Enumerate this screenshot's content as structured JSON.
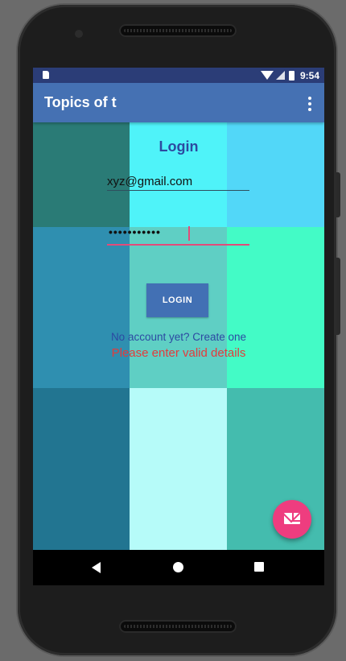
{
  "status_bar": {
    "time": "9:54"
  },
  "app_bar": {
    "title": "Topics of t"
  },
  "login": {
    "title": "Login",
    "email_value": "xyz@gmail.com",
    "password_mask": "•••••••••••",
    "button_label": "LOGIN",
    "create_account_text": "No account yet? Create one",
    "error_text": "Please enter valid details"
  },
  "colors": {
    "status_bar": "#2b3d77",
    "app_bar": "#4571b3",
    "login_title": "#2d4aa0",
    "error": "#e33b3b",
    "fab": "#ee3d7f",
    "grid": [
      "#2a7b76",
      "#4ff3f9",
      "#52d7f8",
      "#2f8fb0",
      "#5fcfc4",
      "#43fbc6",
      "#227591",
      "#b6fbf9",
      "#44bcae"
    ]
  },
  "icons": {
    "overflow": "more-vert-icon",
    "fab": "mail-icon",
    "nav_back": "back-triangle-icon",
    "nav_home": "home-circle-icon",
    "nav_recents": "recents-square-icon"
  }
}
